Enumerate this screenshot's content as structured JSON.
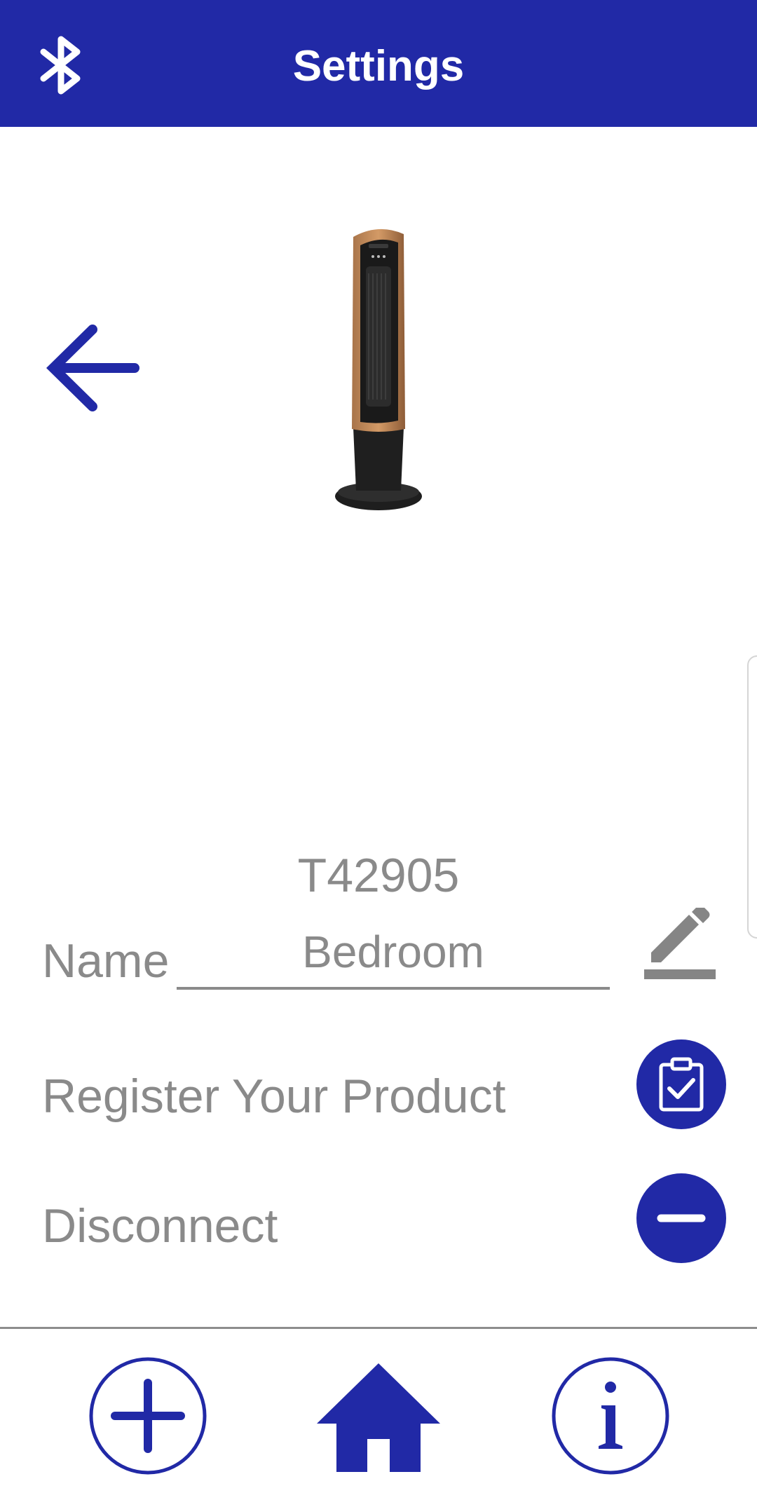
{
  "header": {
    "title": "Settings",
    "icon": "bluetooth-icon"
  },
  "device": {
    "model": "T42905",
    "image": "tower-fan-product-image"
  },
  "name_row": {
    "label": "Name",
    "value": "Bedroom",
    "icon": "pencil-icon"
  },
  "register_row": {
    "label": "Register Your Product",
    "icon": "clipboard-check-icon"
  },
  "disconnect_row": {
    "label": "Disconnect",
    "icon": "minus-icon"
  },
  "bottom_nav": {
    "items": [
      {
        "icon": "plus-icon"
      },
      {
        "icon": "home-icon"
      },
      {
        "icon": "info-icon"
      }
    ]
  },
  "colors": {
    "brand_blue": "#2129a6",
    "text_gray": "#8a8a8a",
    "white": "#ffffff"
  }
}
